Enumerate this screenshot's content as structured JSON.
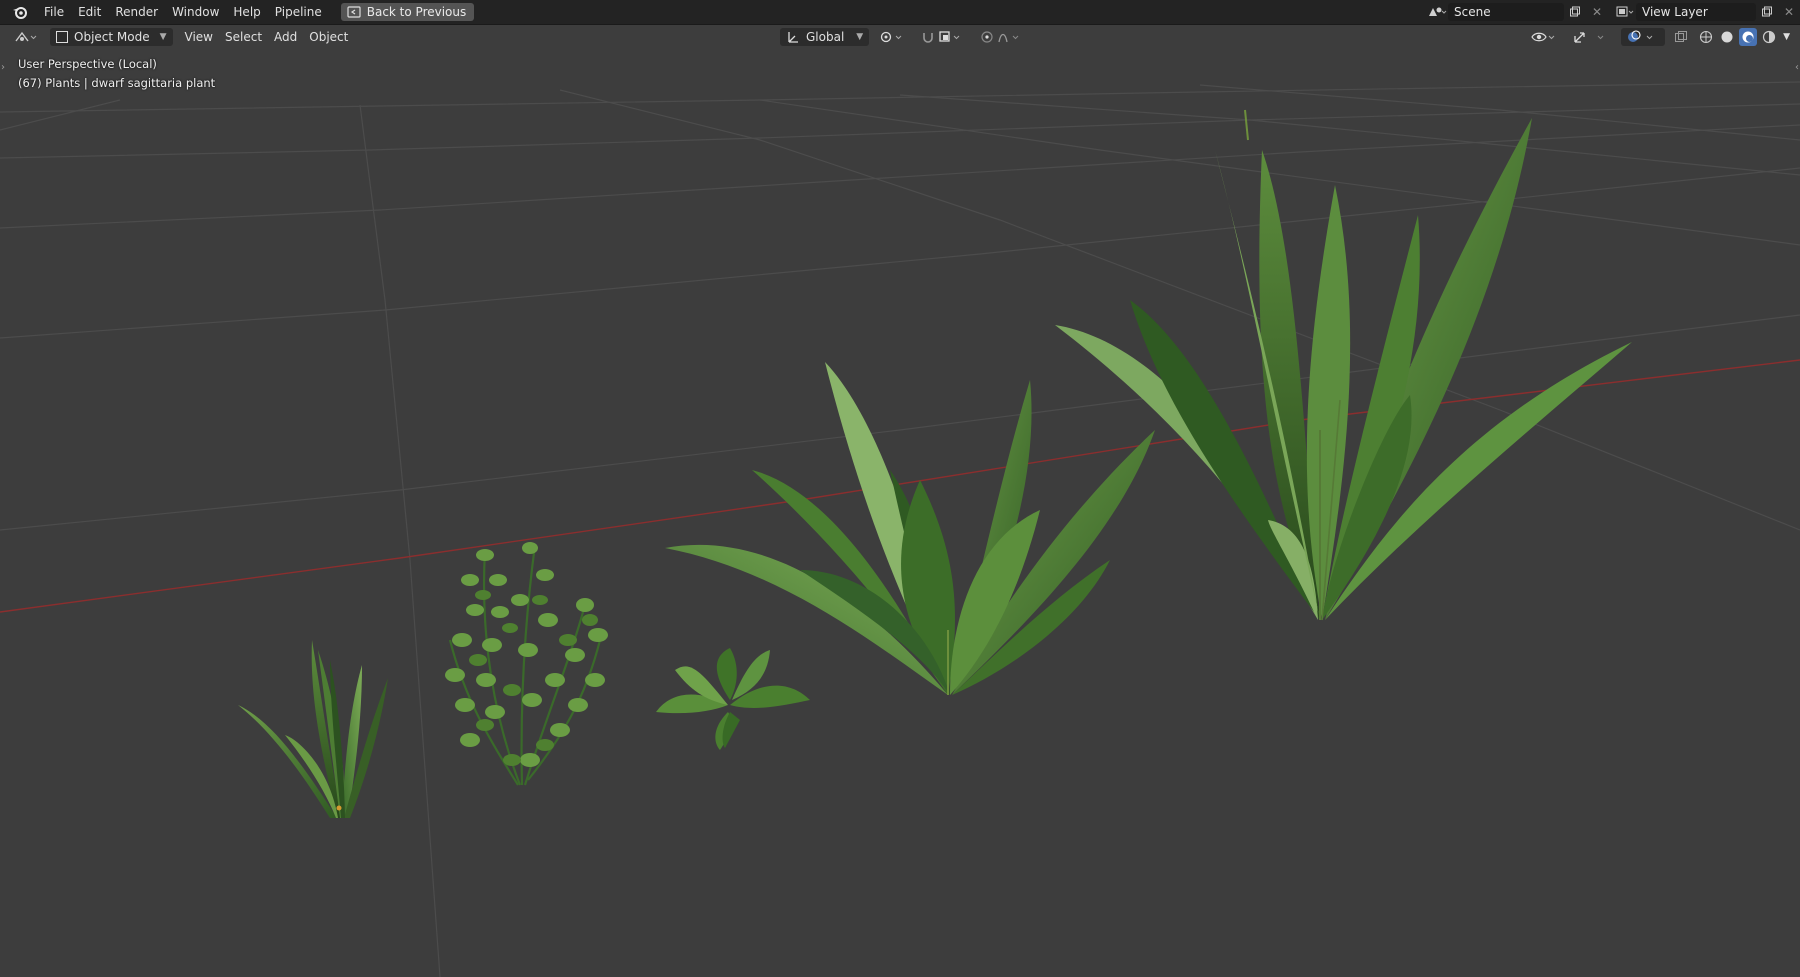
{
  "menubar": {
    "items": [
      "File",
      "Edit",
      "Render",
      "Window",
      "Help",
      "Pipeline"
    ],
    "back_button": "Back to Previous",
    "scene_name": "Scene",
    "view_layer_name": "View Layer"
  },
  "header": {
    "mode": "Object Mode",
    "menus": [
      "View",
      "Select",
      "Add",
      "Object"
    ],
    "transform_orientation": "Global"
  },
  "viewport": {
    "perspective_label": "User Perspective (Local)",
    "object_info": "(67) Plants | dwarf sagittaria plant",
    "objects": [
      "grass tuft",
      "round-leaf stem plant",
      "small leafy plant",
      "broadleaf plant",
      "tall sword plant"
    ]
  },
  "colors": {
    "background": "#3d3d3d",
    "topbar": "#232323",
    "grid": "#4a4a4a",
    "x_axis": "#8b2e2e",
    "leaf_dark": "#2f5a22",
    "leaf_light": "#6f9e4a"
  }
}
